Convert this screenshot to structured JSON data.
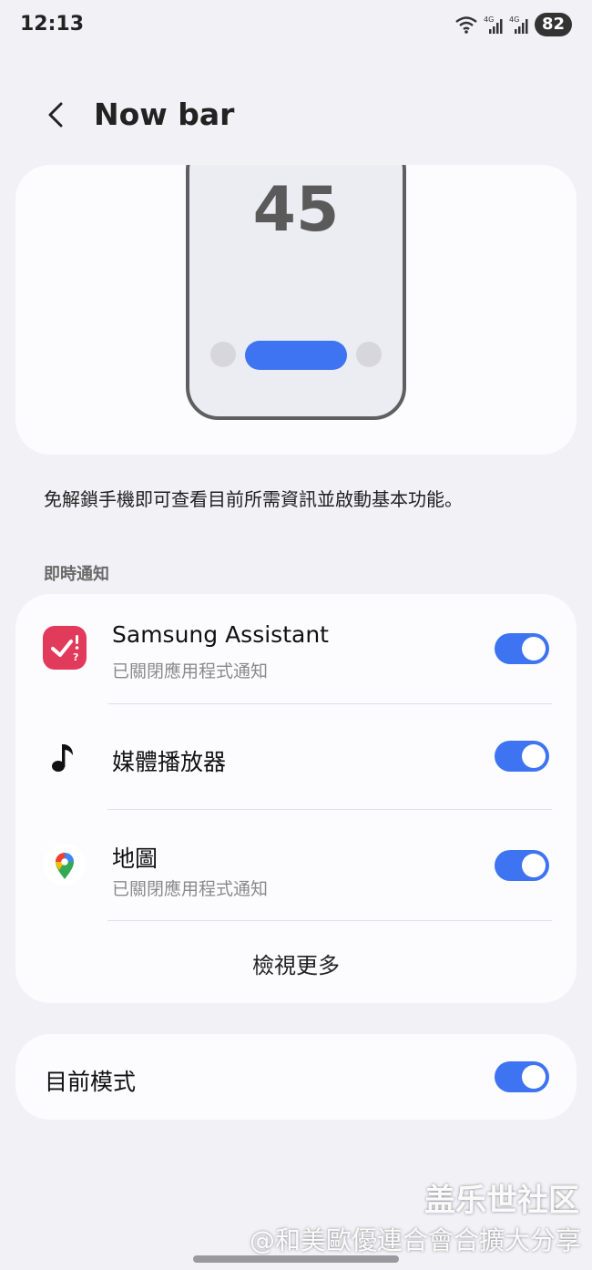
{
  "status_bar": {
    "time": "12:13",
    "battery": "82",
    "network_labels": [
      "4G",
      "4G"
    ]
  },
  "header": {
    "title": "Now bar",
    "back_icon": "chevron-left-icon"
  },
  "preview": {
    "clock": "45",
    "accent_color": "#3e74f2"
  },
  "description": "免解鎖手機即可查看目前所需資訊並啟動基本功能。",
  "live_notifications": {
    "section_title": "即時通知",
    "items": [
      {
        "title": "Samsung Assistant",
        "subtitle": "已關閉應用程式通知",
        "icon": "samsung-assistant-icon",
        "enabled": true
      },
      {
        "title": "媒體播放器",
        "subtitle": "",
        "icon": "music-note-icon",
        "enabled": true
      },
      {
        "title": "地圖",
        "subtitle": "已關閉應用程式通知",
        "icon": "maps-pin-icon",
        "enabled": true
      }
    ],
    "view_more": "檢視更多"
  },
  "current_mode": {
    "label": "目前模式",
    "enabled": true
  },
  "watermark": {
    "line1": "盖乐世社区",
    "line2": "@和美歐優連合會合擴大分享"
  }
}
